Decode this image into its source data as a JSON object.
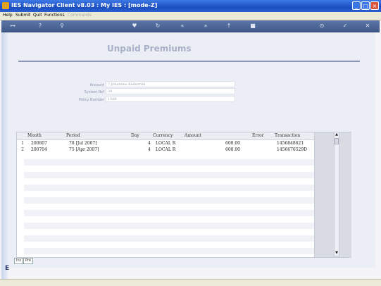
{
  "window": {
    "title": "IES Navigator Client v8.03 : My IES :  [mode-Z]"
  },
  "menu": {
    "items": [
      "Help",
      "Submit",
      "Quit",
      "Functions"
    ],
    "disabled_item": "Commands"
  },
  "toolbar": {
    "icons": [
      "key-icon",
      "help-icon",
      "search-icon",
      "heart-icon",
      "refresh-icon",
      "rewind-icon",
      "forward-icon",
      "up-icon",
      "stop-icon",
      "save-icon",
      "check-icon",
      "close-icon"
    ]
  },
  "page": {
    "title": "Unpaid Premiums"
  },
  "form": {
    "account": {
      "label": "Account",
      "value": "? Johannes Kerkorrel"
    },
    "system_ref": {
      "label": "System Ref",
      "value": "34"
    },
    "policy_number": {
      "label": "Policy Number",
      "value": "1566"
    }
  },
  "table": {
    "columns": [
      "Month",
      "Period",
      "Day",
      "Currency",
      "Amount",
      "Error",
      "Transaction"
    ],
    "rows": [
      {
        "num": "1",
        "month": "200807",
        "period": "78  [Jul 2007]",
        "day": "4",
        "currency": "LOCAL R",
        "amount": "600.00",
        "error": "",
        "transaction": "1456848621"
      },
      {
        "num": "2",
        "month": "200704",
        "period": "75  [Apr 2007]",
        "day": "4",
        "currency": "LOCAL R",
        "amount": "600.00",
        "error": "",
        "transaction": "1456676529D"
      }
    ]
  },
  "tabs": [
    "Inc",
    "Pre"
  ],
  "colors": {
    "titlebar": "#1b4fc0",
    "toolbar": "#4a6496",
    "page_title": "#a7b0c6"
  }
}
